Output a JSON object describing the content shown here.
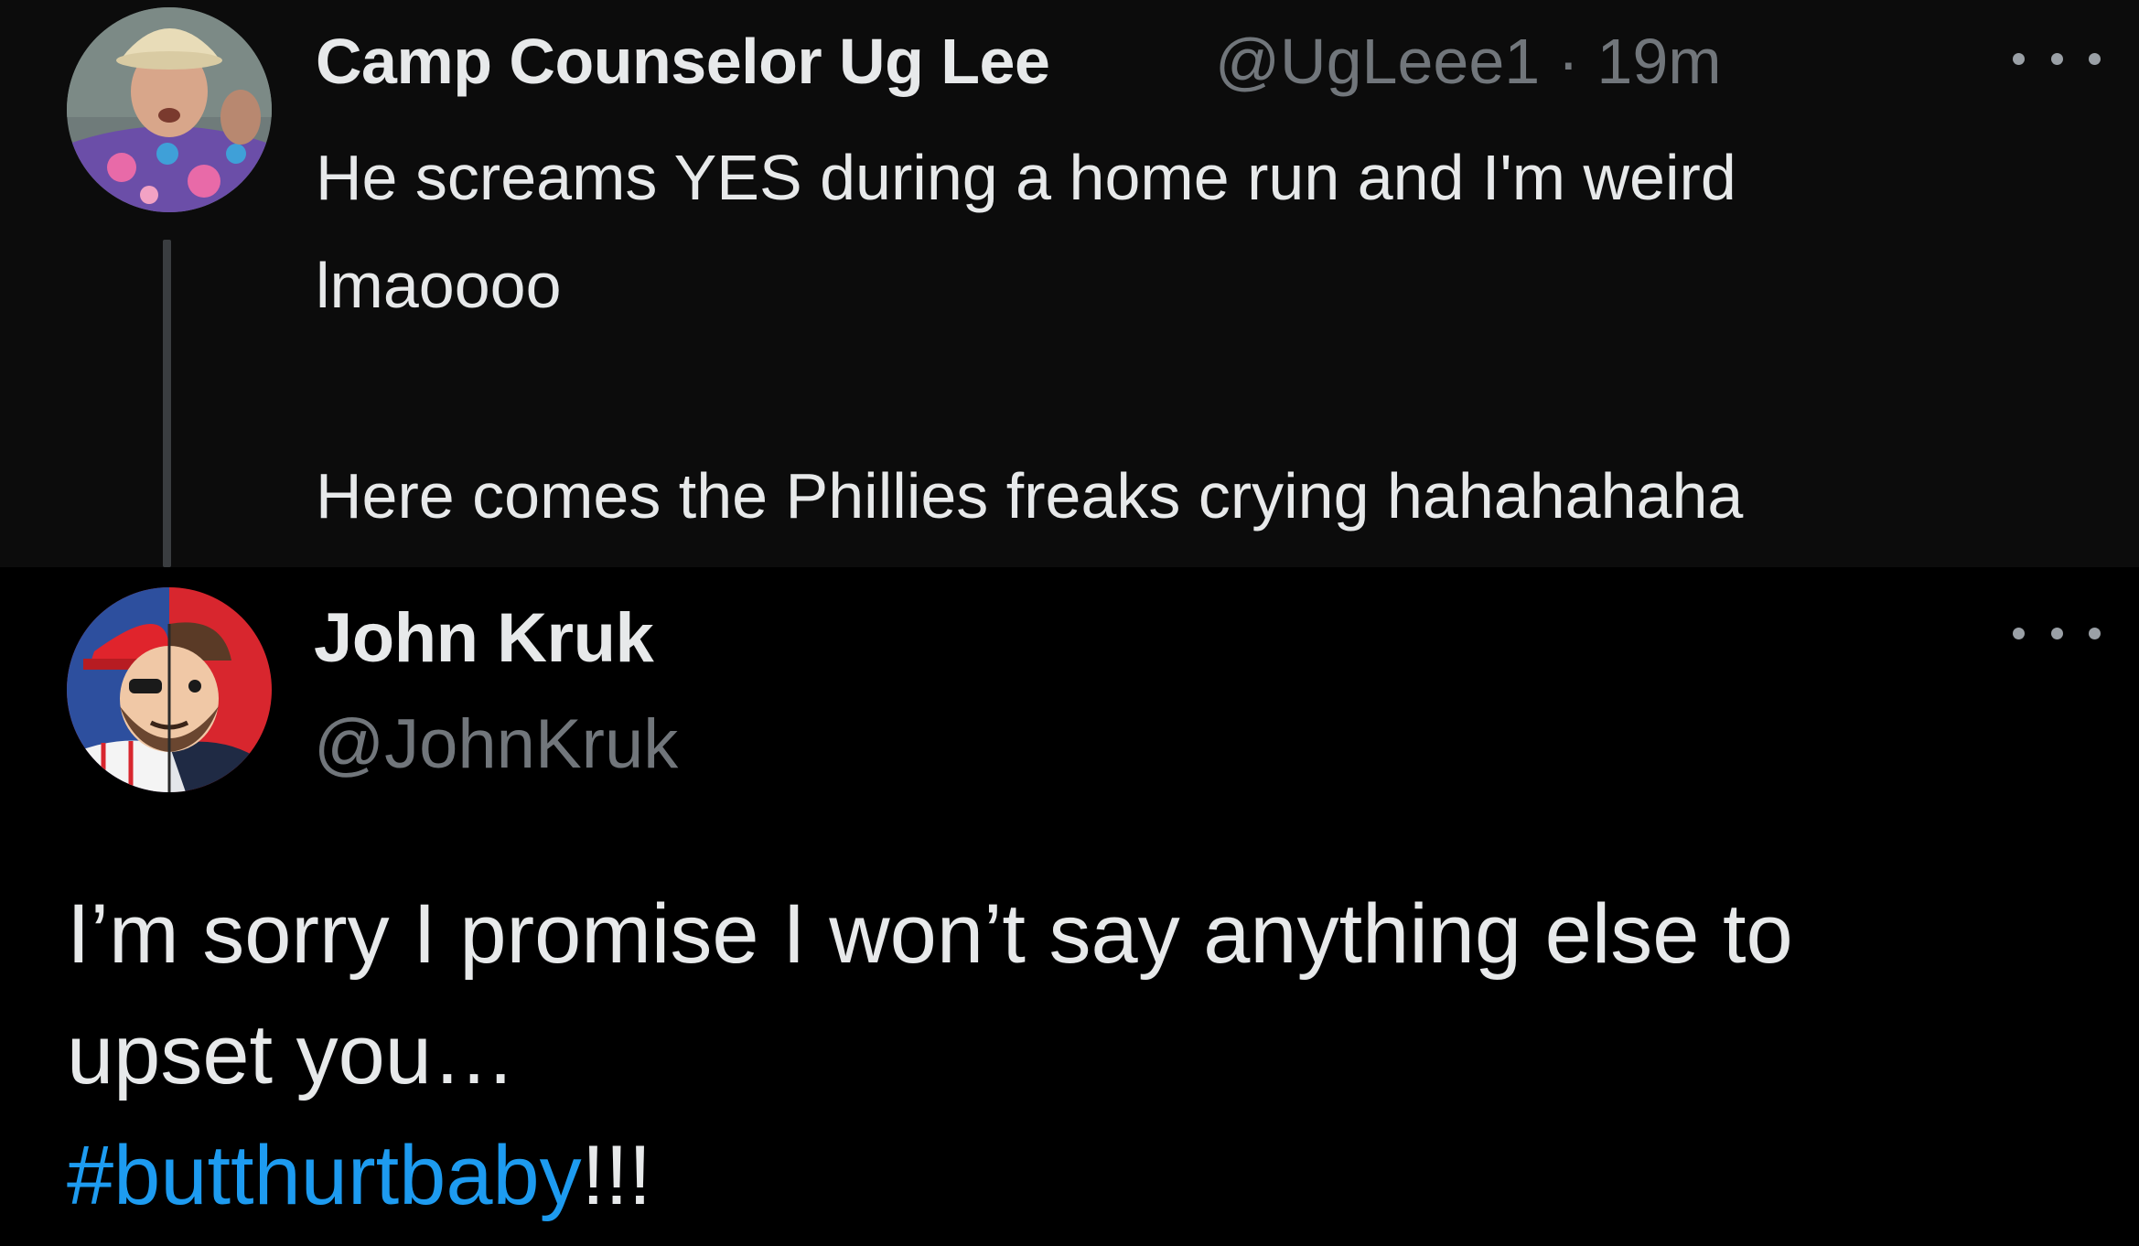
{
  "parent_tweet": {
    "author_name": "Camp Counselor Ug Lee",
    "handle": "@UgLeee1",
    "separator": "·",
    "time": "19m",
    "lines": [
      "He screams YES during a home run and I'm weird",
      "lmaoooo",
      "Here comes the Phillies freaks crying hahahahaha"
    ],
    "avatar_icon": "user-avatar-photo",
    "more_icon": "more-options-icon"
  },
  "main_tweet": {
    "author_name": "John Kruk",
    "handle": "@JohnKruk",
    "lines": [
      "I’m sorry I promise I won’t say anything else to",
      "upset you…"
    ],
    "hashtag": "#butthurtbaby",
    "hashtag_suffix": "!!!",
    "avatar_icon": "user-avatar-illustration",
    "more_icon": "more-options-icon"
  },
  "colors": {
    "background": "#000000",
    "parent_background": "#0c0c0c",
    "primary_text": "#e7e9ea",
    "secondary_text": "#71767b",
    "link": "#1d9bf0",
    "thread_line": "#3a3d40"
  }
}
